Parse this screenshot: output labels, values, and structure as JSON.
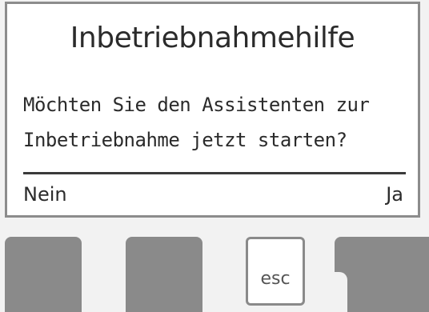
{
  "screen": {
    "title": "Inbetriebnahmehilfe",
    "message_line1": "Möchten Sie den Assistenten zur",
    "message_line2": "Inbetriebnahme jetzt starten?",
    "softkey_left": "Nein",
    "softkey_right": "Ja"
  },
  "buttons": {
    "esc_label": "esc"
  },
  "colors": {
    "background": "#f2f2f2",
    "screen": "#ffffff",
    "button": "#8a8a8a",
    "text": "#2b2b2b"
  }
}
